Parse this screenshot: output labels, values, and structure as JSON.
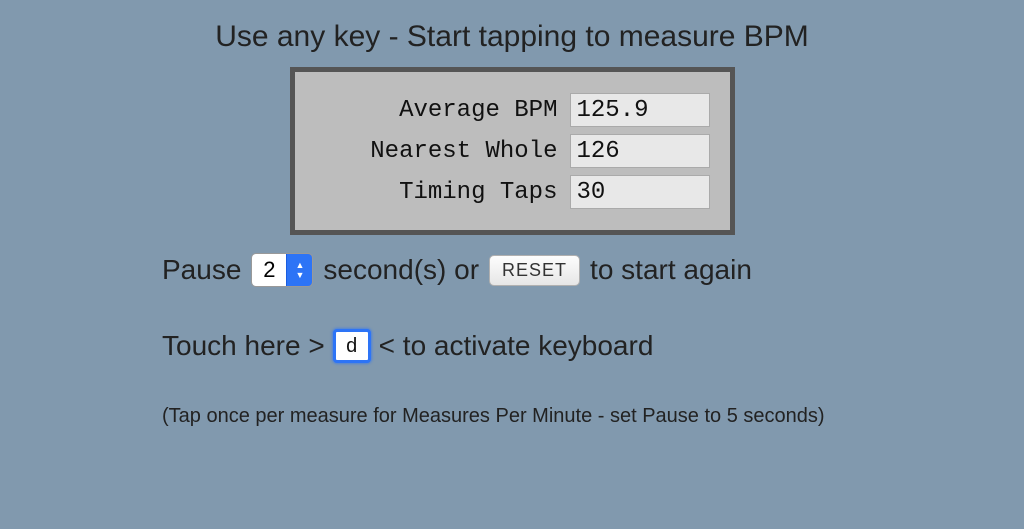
{
  "heading": "Use any key - Start tapping to measure BPM",
  "stats": {
    "average_bpm": {
      "label": "Average BPM",
      "value": "125.9"
    },
    "nearest_whole": {
      "label": "Nearest Whole",
      "value": "126"
    },
    "timing_taps": {
      "label": "Timing Taps",
      "value": "30"
    }
  },
  "pause_row": {
    "prefix": "Pause",
    "seconds_value": "2",
    "seconds_suffix": "second(s) or",
    "reset_label": "RESET",
    "suffix": "to start again"
  },
  "touch_row": {
    "prefix": "Touch here >",
    "input_value": "d",
    "suffix": "< to activate keyboard"
  },
  "hint": "(Tap once per measure for Measures Per Minute - set Pause to 5 seconds)"
}
